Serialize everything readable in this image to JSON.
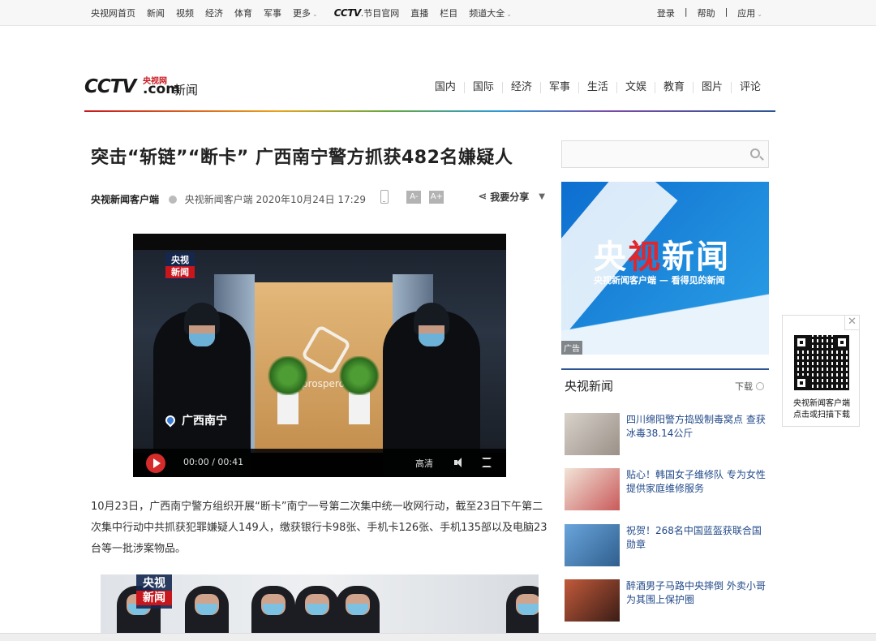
{
  "topbar": {
    "links": [
      "央视网首页",
      "新闻",
      "视频",
      "经济",
      "体育",
      "军事",
      "更多"
    ],
    "cctv_mini": "CCTV",
    "cctv_mini_suffix": ".节目官网",
    "links2": [
      "直播",
      "栏目",
      "频道大全"
    ],
    "right": [
      "登录",
      "|",
      "帮助",
      "|",
      "应用"
    ]
  },
  "header": {
    "logo_cctv": "CCTV",
    "logo_yang": "央视网",
    "logo_com": ".com",
    "logo_section": "新闻",
    "nav": [
      "国内",
      "国际",
      "经济",
      "军事",
      "生活",
      "文娱",
      "教育",
      "图片",
      "评论"
    ]
  },
  "article": {
    "title": "突击“斩链”“断卡” 广西南宁警方抓获482名嫌疑人",
    "source": "央视新闻客户端",
    "info": "央视新闻客户端 2020年10月24日 17:29",
    "font_smaller": "A-",
    "font_larger": "A+",
    "share": "我要分享",
    "video": {
      "badge_top": "央视",
      "badge_bottom": "新闻",
      "prosperous": "#prosperous",
      "location": "广西南宁",
      "time_current": "00:00",
      "time_sep": "/",
      "time_total": "00:41",
      "quality": "高清"
    },
    "paragraph": "10月23日，广西南宁警方组织开展“断卡”南宁一号第二次集中统一收网行动，截至23日下午第二次集中行动中共抓获犯罪嫌疑人149人，缴获银行卡98张、手机卡126张、手机135部以及电脑23台等一批涉案物品。",
    "image2_badge_top": "央视",
    "image2_badge_bottom": "新闻"
  },
  "sidebar": {
    "ad": {
      "title_a": "央",
      "title_b": "视",
      "title_c": "新闻",
      "subtitle": "央视新闻客户端 — 看得见的新闻",
      "label": "广告"
    },
    "news": {
      "title": "央视新闻",
      "download": "下载",
      "items": [
        {
          "text": "四川绵阳警方捣毁制毒窝点 查获冰毒38.14公斤",
          "thumb_color": "#b9b3ac"
        },
        {
          "text": "贴心！韩国女子维修队 专为女性提供家庭维修服务",
          "thumb_color": "#c95a5a"
        },
        {
          "text": "祝贺！268名中国蓝盔获联合国勋章",
          "thumb_color": "#3d78b8"
        },
        {
          "text": "醉酒男子马路中央摔倒 外卖小哥为其围上保护圈",
          "thumb_color": "#8a3a2a"
        }
      ]
    }
  },
  "qr": {
    "close": "✕",
    "caption_1": "央视新闻客户端",
    "caption_2": "点击或扫描下载"
  },
  "colors": {
    "accent_red": "#c8161d",
    "accent_blue": "#2a5592",
    "link_blue": "#224a8a"
  }
}
